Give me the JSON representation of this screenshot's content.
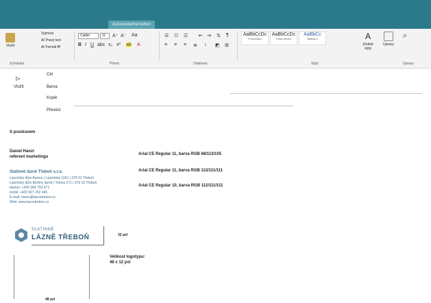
{
  "window": {
    "doc_tab": "Autowiederherstellen"
  },
  "ribbon": {
    "paste_label": "Vložit",
    "cut": "Vyjmout",
    "copy_format": "Ať Pravý text",
    "format_painter": "Ať Formát fff",
    "font_name": "Calibri",
    "font_size": "11",
    "style1_preview": "AaBbCcDc",
    "style1_name": "¶ Normální",
    "style2_preview": "AaBbCcDc",
    "style2_name": "¶ Bez mezer",
    "style3_preview": "AaBbCc",
    "style3_name": "Nadpis 1",
    "change_styles": "Změnit styly",
    "find_label": "Úpravy",
    "groups": {
      "clipboard": "Schránka",
      "font": "Písmo",
      "paragraph": "Odstavec",
      "styles": "Styly",
      "edit": "Úpravy"
    }
  },
  "left_pane": {
    "paste_label": "Vložit",
    "items": [
      "Ctrl",
      "Barva",
      "Kopie",
      "Převést"
    ]
  },
  "document": {
    "greeting": "S pozdravem",
    "name": "Daniel Hanzr",
    "role": "referent marketingu",
    "font_note_1": "Arial CE Regular 11, barva RGB 68/113/105",
    "company": "Slatinné lázně Třeboň s.r.o.",
    "addr1": "Lázeňský dům Aurora | Lázeňská 1001 | 379 01 Třeboň",
    "addr2": "Lázeňský dům Bertiny lázně | Tylova 171 | 379 16 Třeboň",
    "phone": "telefon: +420 384 750 671",
    "mobile": "mobil: +420 607 202 445",
    "email": "E-mail: hanzr@laznetrebon.cz",
    "web": "Web: www.laznetrebon.cz",
    "font_note_2": "Arial CE Regular 11, barva RGB 112/111/111",
    "font_note_3": "Arial CE Regular 10, barva RGB 112/111/111",
    "logo_top": "SLATINNÉ",
    "logo_bottom": "LÁZNĚ TŘEBOŇ",
    "logo_width_label": "32 pxl",
    "logo_size_title": "Velikost logotypu:",
    "logo_size_value": "48 x 12 pxl",
    "height_label": "48 pxl"
  },
  "colors": {
    "titlebar": "#2b7a8c",
    "logo_blue": "#2f5f7c"
  }
}
